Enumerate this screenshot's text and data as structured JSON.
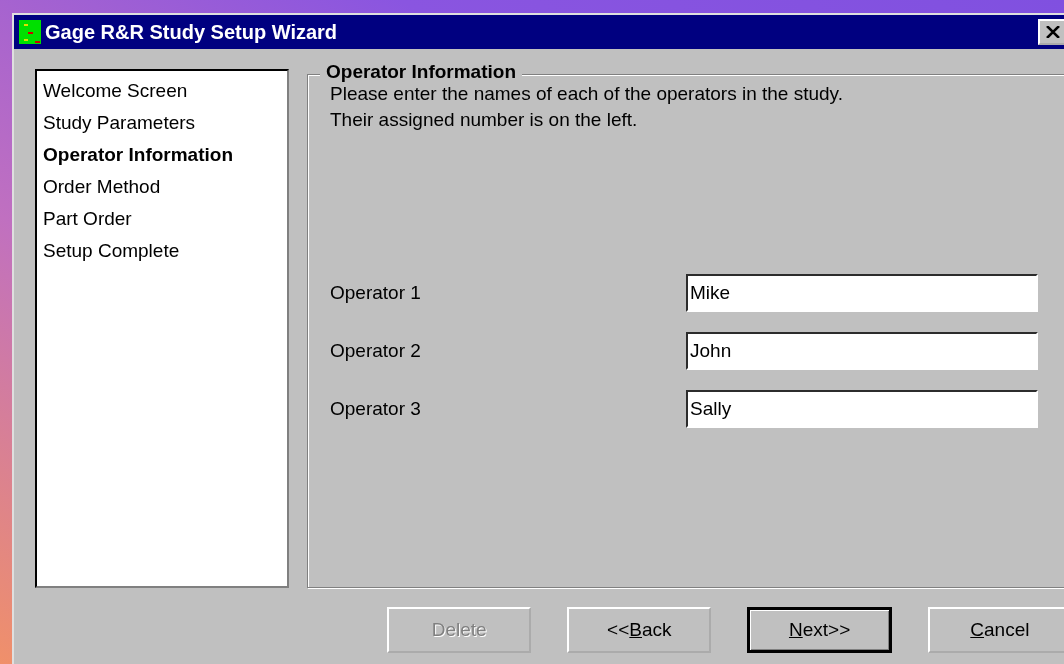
{
  "window": {
    "title": "Gage R&R Study Setup Wizard"
  },
  "steps": [
    {
      "label": "Welcome Screen",
      "selected": false
    },
    {
      "label": "Study Parameters",
      "selected": false
    },
    {
      "label": "Operator Information",
      "selected": true
    },
    {
      "label": "Order Method",
      "selected": false
    },
    {
      "label": "Part Order",
      "selected": false
    },
    {
      "label": "Setup Complete",
      "selected": false
    }
  ],
  "group": {
    "title": "Operator Information",
    "description": "Please enter the names of each of the operators in the study. Their assigned number is on the left."
  },
  "operators": [
    {
      "label": "Operator 1",
      "value": "Mike"
    },
    {
      "label": "Operator 2",
      "value": "John"
    },
    {
      "label": "Operator 3",
      "value": "Sally"
    }
  ],
  "buttons": [
    {
      "before": "Delete",
      "disabled": true,
      "default": false
    },
    {
      "before": "<<",
      "key": "B",
      "after": "ack",
      "disabled": false,
      "default": false
    },
    {
      "key": "N",
      "after": "ext>>",
      "disabled": false,
      "default": true
    },
    {
      "key": "C",
      "after": "ancel",
      "disabled": false,
      "default": false
    }
  ]
}
